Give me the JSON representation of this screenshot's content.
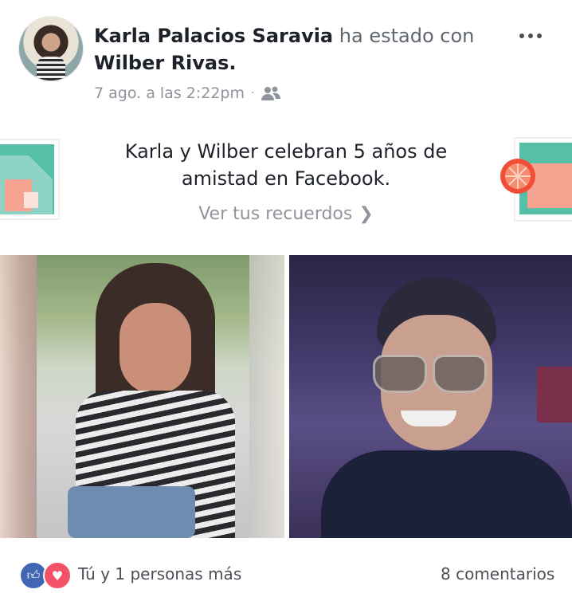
{
  "header": {
    "author": "Karla Palacios Saravia",
    "connector": "ha estado con",
    "tagged": "Wilber Rivas.",
    "timestamp": "7 ago. a las 2:22pm",
    "separator": "·",
    "privacy_icon": "friends-icon",
    "more_icon": "more-options-icon"
  },
  "memory": {
    "text": "Karla y Wilber celebran 5 años de amistad en Facebook.",
    "link": "Ver tus recuerdos",
    "link_icon": "chevron-right-icon"
  },
  "photos": [
    {
      "description_icon": "photo-left"
    },
    {
      "description_icon": "photo-right"
    }
  ],
  "footer": {
    "reactions_text": "Tú y 1 personas más",
    "comments": "8 comentarios",
    "reaction_icons": [
      "like-icon",
      "love-icon"
    ]
  },
  "colors": {
    "like": "#4267b2",
    "love": "#f25268",
    "text": "#1d2129",
    "muted": "#90949c"
  }
}
